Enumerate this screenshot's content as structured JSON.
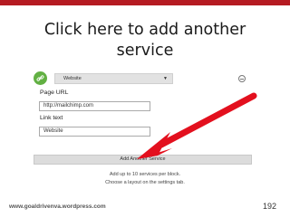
{
  "slide": {
    "title_line1": "Click here to add another",
    "title_line2": "service",
    "footer_url": "www.goaldrivenva.wordpress.com",
    "page_number": "192",
    "accent_color": "#b51b22"
  },
  "form": {
    "service_icon": "link-icon",
    "service_select_value": "Website",
    "page_url_label": "Page URL",
    "page_url_value": "http://mailchimp.com",
    "link_text_label": "Link text",
    "link_text_value": "Website",
    "add_button_label": "Add Another Service",
    "note_line1": "Add up to 10 services per block.",
    "note_line2": "Choose a layout on the settings tab."
  }
}
